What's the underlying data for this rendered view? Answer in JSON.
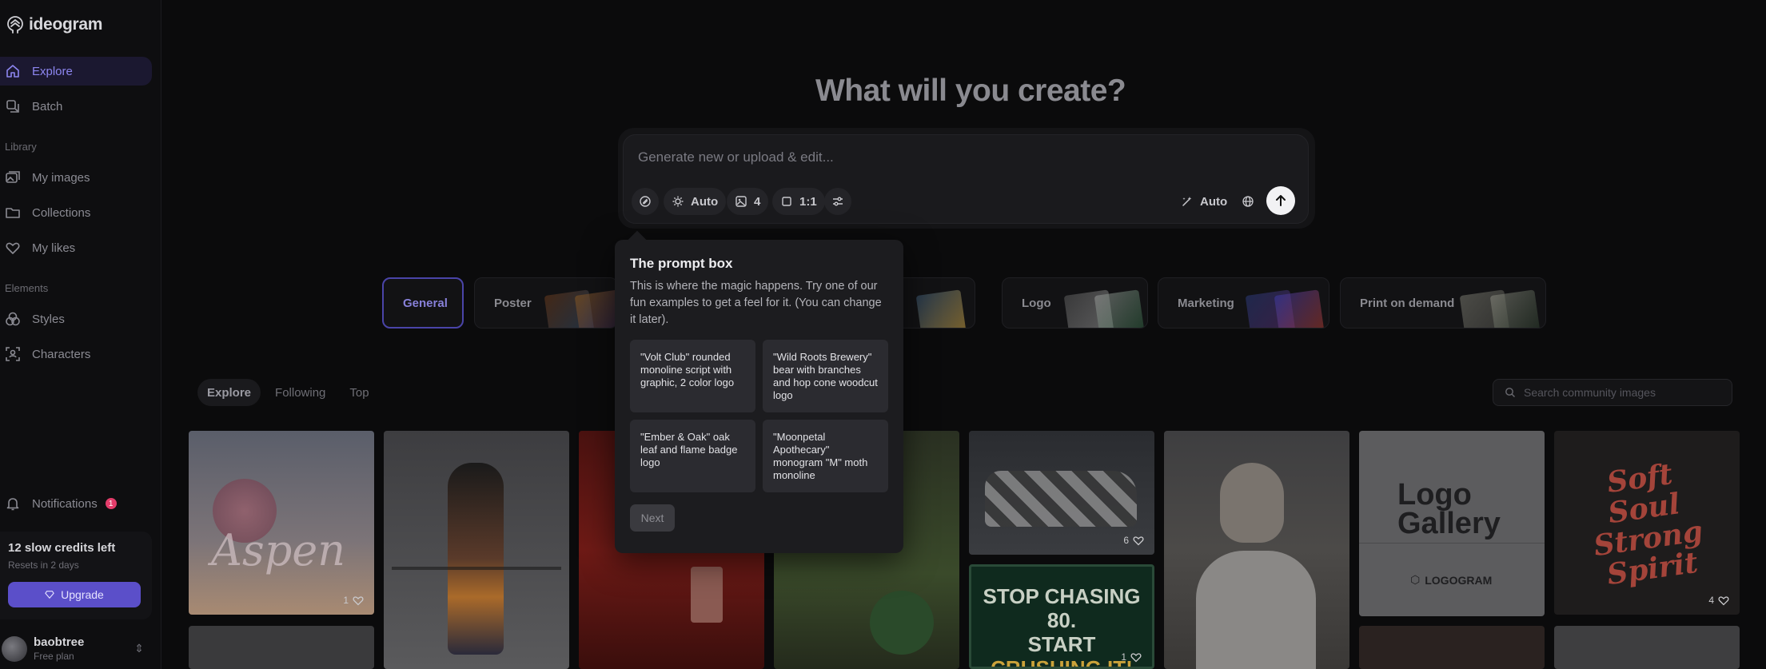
{
  "app": {
    "name": "ideogram"
  },
  "sidebar": {
    "nav": [
      {
        "label": "Explore",
        "icon": "home-icon",
        "active": true
      },
      {
        "label": "Batch",
        "icon": "batch-icon",
        "active": false
      }
    ],
    "library_label": "Library",
    "library": [
      {
        "label": "My images",
        "icon": "images-icon"
      },
      {
        "label": "Collections",
        "icon": "folder-icon"
      },
      {
        "label": "My likes",
        "icon": "heart-icon"
      }
    ],
    "elements_label": "Elements",
    "elements": [
      {
        "label": "Styles",
        "icon": "styles-icon"
      },
      {
        "label": "Characters",
        "icon": "characters-icon"
      }
    ],
    "notifications": {
      "label": "Notifications",
      "count": "1"
    },
    "credits": {
      "title": "12 slow credits left",
      "subtitle": "Resets in 2 days",
      "upgrade_label": "Upgrade"
    },
    "user": {
      "name": "baobtree",
      "plan": "Free plan"
    }
  },
  "main": {
    "headline": "What will you create?",
    "prompt": {
      "placeholder": "Generate new or upload & edit...",
      "chips": {
        "style": "Auto",
        "count": "4",
        "aspect": "1:1",
        "magic": "Auto"
      }
    },
    "categories": [
      {
        "label": "General",
        "active": true
      },
      {
        "label": "Poster",
        "active": false
      },
      {
        "label": "Logo",
        "active": false
      },
      {
        "label": "Marketing",
        "active": false
      },
      {
        "label": "Print on demand",
        "active": false
      }
    ],
    "feed_tabs": [
      "Explore",
      "Following",
      "Top"
    ],
    "search_placeholder": "Search community images",
    "gallery": {
      "likes": [
        "1",
        "6",
        "1",
        "4"
      ],
      "card_texts": {
        "logo_gallery_line1": "Logo",
        "logo_gallery_line2": "Gallery",
        "logogram": "LOGOGRAM",
        "golf_line1": "STOP CHASING 80.",
        "golf_line2a": "START ",
        "golf_line2b": "CRUSHING IT!",
        "soft_soul": "Soft Soul Strong Spirit",
        "aspen": "Aspen"
      }
    }
  },
  "tooltip": {
    "title": "The prompt box",
    "body": "This is where the magic happens. Try one of our fun examples to get a feel for it. (You can change it later).",
    "examples": [
      "\"Volt Club\" rounded monoline script with graphic, 2 color logo",
      "\"Wild Roots Brewery\" bear with branches and hop cone woodcut logo",
      "\"Ember & Oak\" oak leaf and flame badge logo",
      "\"Moonpetal Apothecary\" monogram \"M\" moth monoline"
    ],
    "next_label": "Next"
  },
  "colors": {
    "accent": "#8d86f0",
    "upgrade": "#5b4fc9",
    "badge": "#e23c6a"
  }
}
